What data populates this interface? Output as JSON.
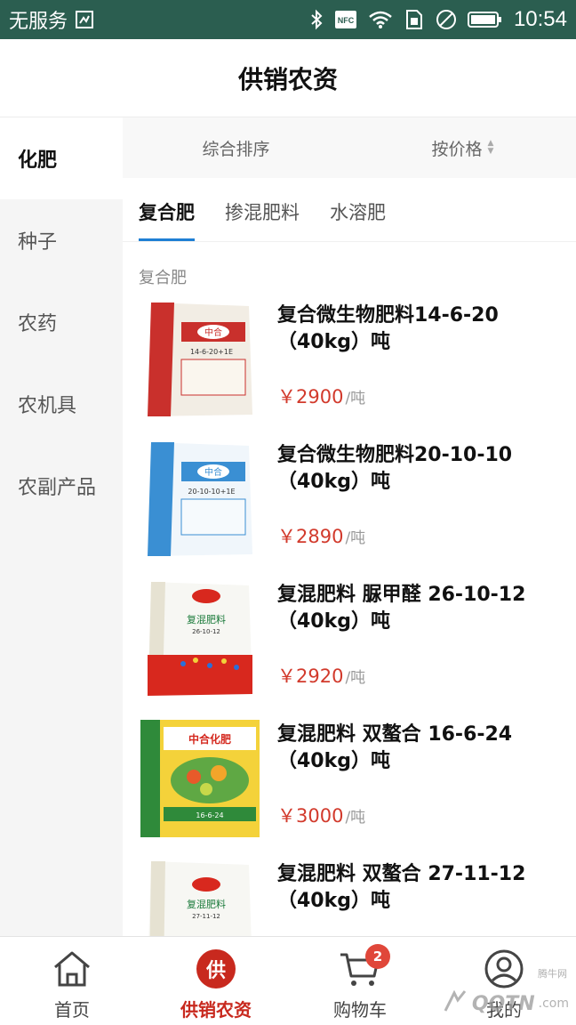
{
  "status_bar": {
    "carrier": "无服务",
    "time": "10:54",
    "icons": [
      "sim-icon",
      "bluetooth-icon",
      "nfc-icon",
      "wifi-icon",
      "sim-card-icon",
      "do-not-disturb-icon",
      "battery-icon"
    ],
    "nfc_label": "NFC"
  },
  "header": {
    "title": "供销农资"
  },
  "sidebar": {
    "items": [
      {
        "label": "化肥",
        "active": true
      },
      {
        "label": "种子"
      },
      {
        "label": "农药"
      },
      {
        "label": "农机具"
      },
      {
        "label": "农副产品"
      }
    ]
  },
  "sort": {
    "default_label": "综合排序",
    "price_label": "按价格"
  },
  "tabs": [
    {
      "label": "复合肥",
      "active": true
    },
    {
      "label": "掺混肥料"
    },
    {
      "label": "水溶肥"
    }
  ],
  "section_label": "复合肥",
  "products": [
    {
      "name": "复合微生物肥料14-6-20（40kg）吨",
      "price": "￥2900",
      "unit": "/吨",
      "bag": "red",
      "bag_label": "中合",
      "bag_sub": "14-6-20+1E"
    },
    {
      "name": "复合微生物肥料20-10-10（40kg）吨",
      "price": "￥2890",
      "unit": "/吨",
      "bag": "blue",
      "bag_label": "中合",
      "bag_sub": "20-10-10+1E"
    },
    {
      "name": "复混肥料 脲甲醛 26-10-12（40kg）吨",
      "price": "￥2920",
      "unit": "/吨",
      "bag": "white-red",
      "bag_label": "复混肥料",
      "bag_sub": "26-10-12"
    },
    {
      "name": "复混肥料 双螯合 16-6-24（40kg）吨",
      "price": "￥3000",
      "unit": "/吨",
      "bag": "green",
      "bag_label": "中合化肥",
      "bag_sub": "16-6-24"
    },
    {
      "name": "复混肥料 双螯合 27-11-12（40kg）吨",
      "price": "",
      "unit": "",
      "bag": "white-green",
      "bag_label": "复混肥料",
      "bag_sub": "27-11-12"
    }
  ],
  "bottom_nav": [
    {
      "label": "首页",
      "icon": "home-icon"
    },
    {
      "label": "供销农资",
      "icon": "gong-icon",
      "glyph": "供",
      "active": true
    },
    {
      "label": "购物车",
      "icon": "cart-icon",
      "badge": "2"
    },
    {
      "label": "我的",
      "icon": "user-icon"
    }
  ],
  "watermark": {
    "text": "QQTN",
    "small": "腾牛网",
    "domain": ".com"
  },
  "colors": {
    "status_bar": "#2b5e50",
    "price": "#d23a2c",
    "tab_underline": "#1f7fd4",
    "nav_active": "#c8291e"
  }
}
